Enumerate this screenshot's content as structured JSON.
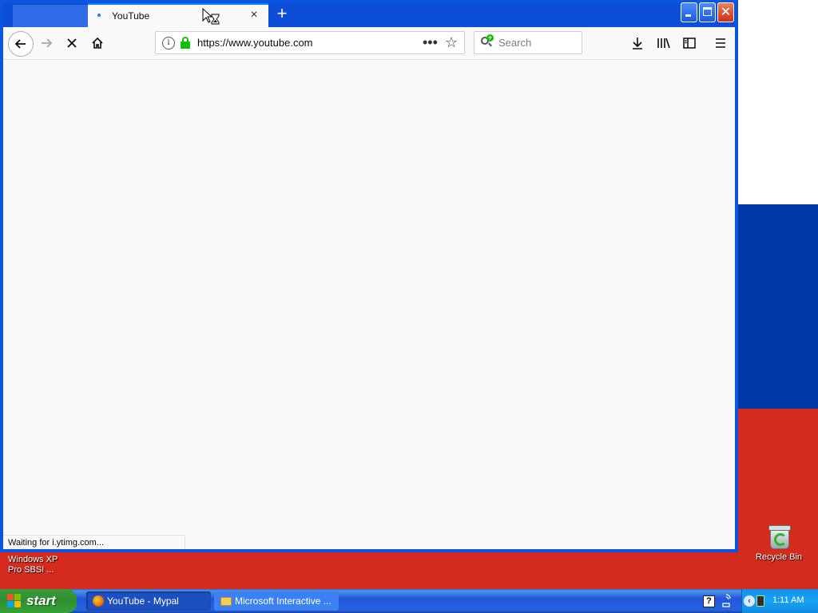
{
  "browser": {
    "tab": {
      "title": "YouTube",
      "close_glyph": "×"
    },
    "new_tab_glyph": "+",
    "url": "https://www.youtube.com",
    "page_actions_glyph": "•••",
    "bookmark_glyph": "☆",
    "search_placeholder": "Search",
    "status_text": "Waiting for i.ytimg.com...",
    "icons": {
      "back": "back-arrow-icon",
      "forward": "forward-arrow-icon",
      "stop": "stop-icon",
      "home": "home-icon",
      "info": "info-icon",
      "lock": "lock-icon",
      "download": "download-icon",
      "library": "library-icon",
      "sidebar": "sidebar-icon",
      "menu": "hamburger-menu-icon"
    },
    "accent_color": "#0a84ff"
  },
  "desktop": {
    "recycle_bin_label": "Recycle Bin",
    "os_label_line1": "Windows XP",
    "os_label_line2": "Pro SBSI ..."
  },
  "taskbar": {
    "start_label": "start",
    "tasks": [
      {
        "label": "YouTube - Mypal",
        "icon": "firefox-icon",
        "active": true
      },
      {
        "label": "Microsoft Interactive ...",
        "icon": "folder-icon",
        "active": false
      }
    ],
    "clock": "1:11 AM"
  }
}
